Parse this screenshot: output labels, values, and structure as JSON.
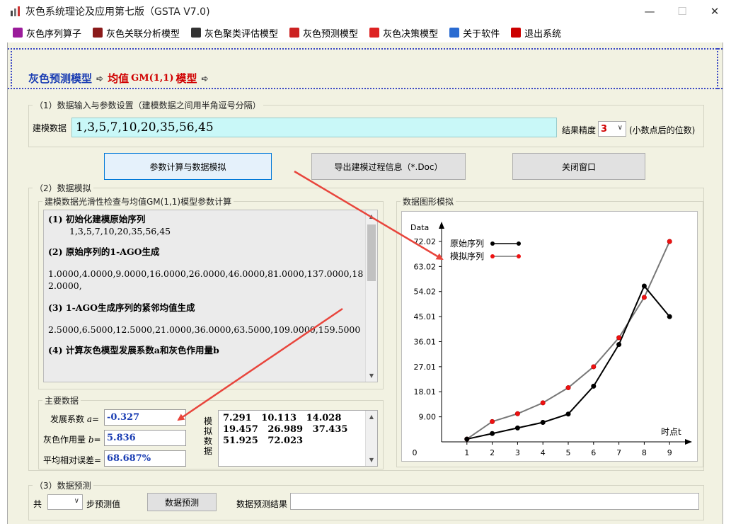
{
  "window": {
    "title": "灰色系统理论及应用第七版（GSTA V7.0)",
    "min_icon": "—",
    "max_icon": "☐",
    "close_icon": "✕"
  },
  "menu": {
    "items": [
      {
        "label": "灰色序列算子",
        "icon": "operator-icon",
        "color": "#9b1c9b"
      },
      {
        "label": "灰色关联分析模型",
        "icon": "relation-icon",
        "color": "#8b1a1a"
      },
      {
        "label": "灰色聚类评估模型",
        "icon": "cluster-icon",
        "color": "#333333"
      },
      {
        "label": "灰色预测模型",
        "icon": "predict-icon",
        "color": "#cc2222"
      },
      {
        "label": "灰色决策模型",
        "icon": "decision-icon",
        "color": "#dd2222"
      },
      {
        "label": "关于软件",
        "icon": "home-icon",
        "color": "#2a6bd1"
      },
      {
        "label": "退出系统",
        "icon": "exit-icon",
        "color": "#cc0000"
      }
    ]
  },
  "breadcrumb": {
    "part1": "灰色预测模型",
    "part2_prefix": "均值",
    "part2_model": "GM(1,1)",
    "part2_suffix": "模型",
    "arrow": "➪"
  },
  "section1": {
    "title": "（1）数据输入与参数设置（建模数据之间用半角逗号分隔）",
    "data_label": "建模数据",
    "data_value": "1,3,5,7,10,20,35,56,45",
    "precision_label": "结果精度",
    "precision_value": "3",
    "precision_hint": "(小数点后的位数)",
    "dropdown_icon": "∨"
  },
  "buttons": {
    "compute": "参数计算与数据模拟",
    "export": "导出建模过程信息（*.Doc）",
    "close": "关闭窗口"
  },
  "section2": {
    "title": "（2）数据模拟",
    "process_title": "建模数据光滑性检查与均值GM(1,1)模型参数计算",
    "process": {
      "s1_title": "(1)  初始化建模原始序列",
      "s1_body": "1,3,5,7,10,20,35,56,45",
      "s2_title": "(2)  原始序列的1-AGO生成",
      "s2_body": "1.0000,4.0000,9.0000,16.0000,26.0000,46.0000,81.0000,137.0000,182.0000,",
      "s3_title": "(3)  1-AGO生成序列的紧邻均值生成",
      "s3_body": "2.5000,6.5000,12.5000,21.0000,36.0000,63.5000,109.0000,159.5000",
      "s4_title": "(4) 计算灰色模型发展系数a和灰色作用量b"
    },
    "chart_title": "数据图形模拟",
    "main_data_title": "主要数据",
    "dev_coef_label": "发展系数",
    "dev_coef_var": "a",
    "dev_coef_value": "-0.327",
    "grey_action_label": "灰色作用量",
    "grey_action_var": "b",
    "grey_action_value": "5.836",
    "avg_err_label": "平均相对误差=",
    "avg_err_value": "68.687%",
    "sim_label": "模拟数据",
    "sim_lines": [
      "7.291   10.113   14.028",
      "19.457   26.989   37.435",
      "51.925   72.023"
    ]
  },
  "section3": {
    "title": "（3）数据预测",
    "total_label": "共",
    "step_label": "步预测值",
    "predict_button": "数据预测",
    "result_label": "数据预测结果"
  },
  "scroll": {
    "up": "▲",
    "down": "▼"
  },
  "chart_data": {
    "type": "line",
    "ylabel": "Data",
    "xlabel": "时点t",
    "x": [
      1,
      2,
      3,
      4,
      5,
      6,
      7,
      8,
      9
    ],
    "xticks": [
      "0",
      "1",
      "2",
      "3",
      "4",
      "5",
      "6",
      "7",
      "8",
      "9"
    ],
    "yticks": [
      "9.00",
      "18.01",
      "27.01",
      "36.01",
      "45.01",
      "54.02",
      "63.02",
      "72.02"
    ],
    "ylim": [
      0,
      72.02
    ],
    "legend_position": "top-left",
    "series": [
      {
        "name": "原始序列",
        "color": "#000000",
        "line_color": "#000000",
        "values": [
          1,
          3,
          5,
          7,
          10,
          20,
          35,
          56,
          45
        ]
      },
      {
        "name": "模拟序列",
        "color": "#ee1111",
        "line_color": "#777777",
        "values": [
          1,
          7.291,
          10.113,
          14.028,
          19.457,
          26.989,
          37.435,
          51.925,
          72.023
        ]
      }
    ]
  }
}
